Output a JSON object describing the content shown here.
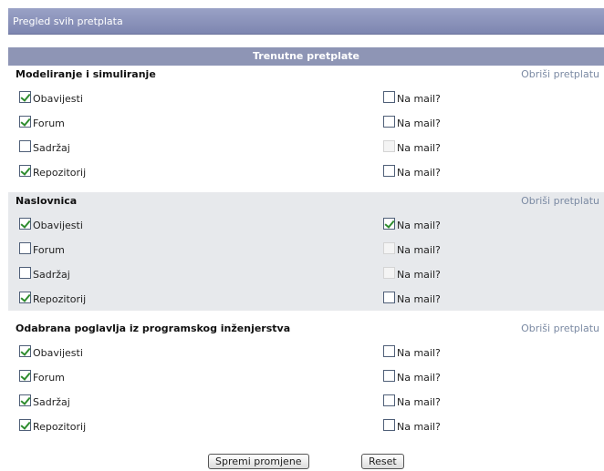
{
  "page_title": "Pregled svih pretplata",
  "table_header": "Trenutne pretplate",
  "unsubscribe_label": "Obriši pretplatu",
  "mail_label": "Na mail?",
  "sections": [
    {
      "title": "Modeliranje i simuliranje",
      "rows": [
        {
          "label": "Obavijesti",
          "checked": true,
          "mail_checked": false,
          "mail_enabled": true
        },
        {
          "label": "Forum",
          "checked": true,
          "mail_checked": false,
          "mail_enabled": true
        },
        {
          "label": "Sadržaj",
          "checked": false,
          "mail_checked": false,
          "mail_enabled": false
        },
        {
          "label": "Repozitorij",
          "checked": true,
          "mail_checked": false,
          "mail_enabled": true
        }
      ]
    },
    {
      "title": "Naslovnica",
      "rows": [
        {
          "label": "Obavijesti",
          "checked": true,
          "mail_checked": true,
          "mail_enabled": true
        },
        {
          "label": "Forum",
          "checked": false,
          "mail_checked": false,
          "mail_enabled": false
        },
        {
          "label": "Sadržaj",
          "checked": false,
          "mail_checked": false,
          "mail_enabled": false
        },
        {
          "label": "Repozitorij",
          "checked": true,
          "mail_checked": false,
          "mail_enabled": true
        }
      ]
    },
    {
      "title": "Odabrana poglavlja iz programskog inženjerstva",
      "rows": [
        {
          "label": "Obavijesti",
          "checked": true,
          "mail_checked": false,
          "mail_enabled": true
        },
        {
          "label": "Forum",
          "checked": true,
          "mail_checked": false,
          "mail_enabled": true
        },
        {
          "label": "Sadržaj",
          "checked": true,
          "mail_checked": false,
          "mail_enabled": true
        },
        {
          "label": "Repozitorij",
          "checked": true,
          "mail_checked": false,
          "mail_enabled": true
        }
      ]
    }
  ],
  "buttons": {
    "save_label": "Spremi promjene",
    "reset_label": "Reset"
  },
  "colors": {
    "title_bar": "#7d86b0",
    "table_header": "#8e95b5",
    "alt_section_bg": "#e7e9ec",
    "link": "#7b8aa3",
    "check": "#2e8c2e"
  }
}
